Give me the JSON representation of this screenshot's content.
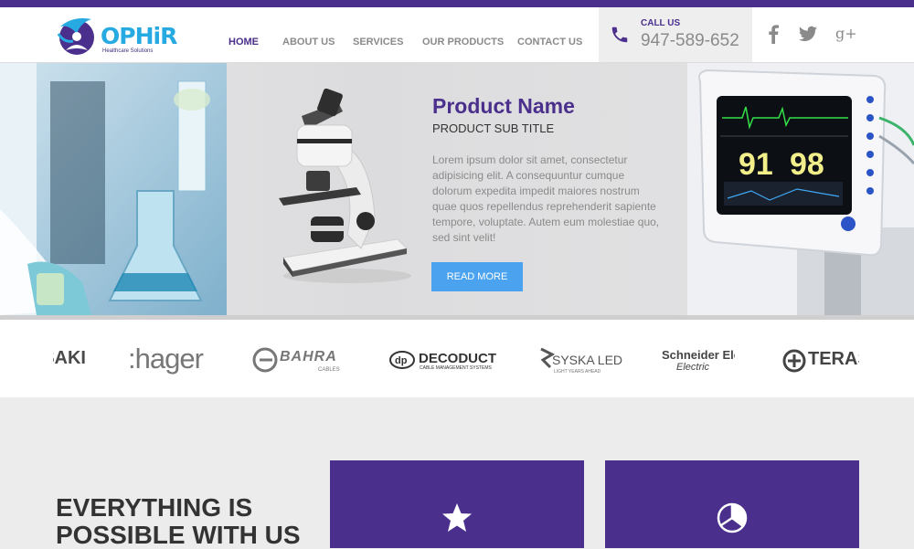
{
  "brand": {
    "logo_text": "OPHiR",
    "logo_subtitle": "Healthcare Solutions",
    "colors": {
      "primary": "#4a2f8c",
      "accent": "#27a9e1",
      "button": "#4ba3f0"
    }
  },
  "nav": {
    "items": [
      "HOME",
      "ABOUT US",
      "SERVICES",
      "OUR PRODUCTS",
      "CONTACT US"
    ],
    "active": "HOME"
  },
  "contact": {
    "label": "CALL US",
    "phone": "947-589-652",
    "icon": "phone-icon"
  },
  "social": {
    "icons": [
      "facebook-icon",
      "twitter-icon",
      "google-plus-icon"
    ],
    "google_plus_text": "g+"
  },
  "hero": {
    "title": "Product Name",
    "subtitle": "PRODUCT SUB TITLE",
    "description": "Lorem ipsum dolor sit amet, consectetur adipisicing elit. A consequuntur cumque dolorum expedita impedit maiores nostrum quae quos repellendus reprehenderit sapiente tempore, voluptate. Autem eum molestiae quo, sed sint velit!",
    "button": "READ MORE",
    "monitor_readings": [
      "91",
      "98"
    ]
  },
  "brands": {
    "items": [
      "SAKI",
      ":hager",
      "BAHRA",
      "DECODUCT",
      "SYSKA LED",
      "Schneider Electric",
      "TERAS"
    ],
    "sublabels": {
      "bahra": "CABLES",
      "decoduct": "CABLE MANAGEMENT SYSTEMS",
      "syska": "LIGHT YEARS AHEAD",
      "schneider": "Electric"
    }
  },
  "features": {
    "headline_line1": "EVERYTHING IS",
    "headline_line2": "POSSIBLE WITH US",
    "cards": [
      {
        "icon": "star-icon"
      },
      {
        "icon": "pie-chart-icon"
      }
    ]
  }
}
